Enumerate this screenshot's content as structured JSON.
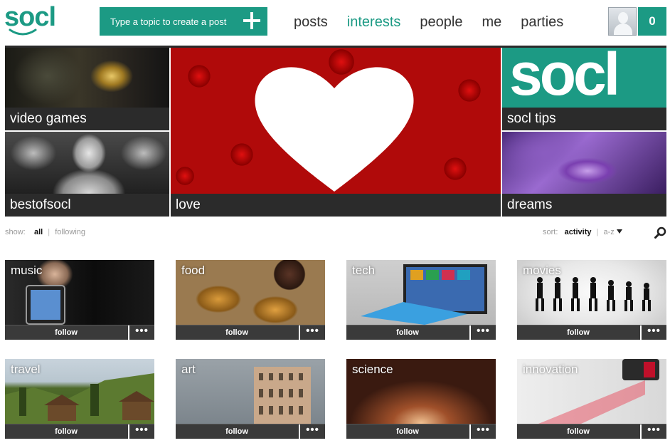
{
  "header": {
    "logo_text": "socl",
    "create_post_label": "Type a topic to create a post",
    "nav": [
      {
        "label": "posts"
      },
      {
        "label": "interests"
      },
      {
        "label": "people"
      },
      {
        "label": "me"
      },
      {
        "label": "parties"
      }
    ],
    "active_nav": "interests",
    "notification_count": "0"
  },
  "hero_tiles": [
    {
      "label": "video games"
    },
    {
      "label": "bestofsocl"
    },
    {
      "label": "love"
    },
    {
      "label": "socl tips",
      "logo_text": "socl"
    },
    {
      "label": "dreams"
    }
  ],
  "filter": {
    "show_label": "show:",
    "show_options": [
      "all",
      "following"
    ],
    "show_selected": "all",
    "sort_label": "sort:",
    "sort_options": [
      "activity",
      "a-z"
    ],
    "sort_selected": "activity"
  },
  "interests": [
    {
      "name": "music",
      "follow_label": "follow",
      "more_label": "•••"
    },
    {
      "name": "food",
      "follow_label": "follow",
      "more_label": "•••"
    },
    {
      "name": "tech",
      "follow_label": "follow",
      "more_label": "•••"
    },
    {
      "name": "movies",
      "follow_label": "follow",
      "more_label": "•••"
    },
    {
      "name": "travel",
      "follow_label": "follow",
      "more_label": "•••"
    },
    {
      "name": "art",
      "follow_label": "follow",
      "more_label": "•••"
    },
    {
      "name": "science",
      "follow_label": "follow",
      "more_label": "•••"
    },
    {
      "name": "innovation",
      "follow_label": "follow",
      "more_label": "•••"
    }
  ],
  "colors": {
    "accent": "#1c9a84",
    "caption_bar": "#2b2b2b",
    "card_bar": "#3a3a3a"
  },
  "icons": [
    "plus-icon",
    "avatar-icon",
    "search-icon",
    "sort-dropdown-icon",
    "more-icon"
  ]
}
